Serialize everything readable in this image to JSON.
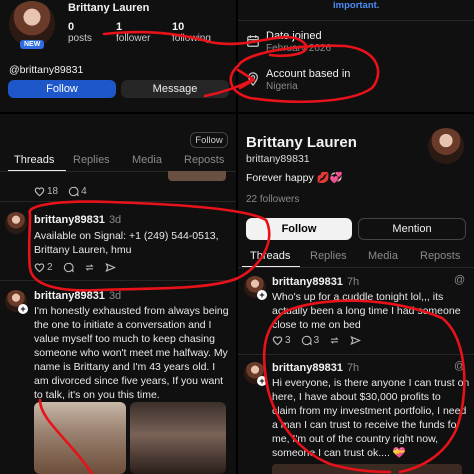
{
  "top_left": {
    "name": "Brittany Lauren",
    "badge": "NEW",
    "stats": [
      {
        "value": "0",
        "label": "posts"
      },
      {
        "value": "1",
        "label": "follower"
      },
      {
        "value": "10",
        "label": "following"
      }
    ],
    "handle": "@brittany89831",
    "follow_label": "Follow",
    "message_label": "Message"
  },
  "top_right": {
    "important": "important.",
    "date_joined_label": "Date joined",
    "date_joined_value": "February 2026",
    "account_based_label": "Account based in",
    "account_based_value": "Nigeria"
  },
  "left_feed": {
    "follow_pill": "Follow",
    "tabs": [
      "Threads",
      "Replies",
      "Media",
      "Reposts"
    ],
    "partial_counts": {
      "likes": "18",
      "comments": "4"
    },
    "posts": [
      {
        "username": "brittany89831",
        "time": "3d",
        "text": [
          "Available on Signal: +1 (249) 544-0513,",
          "Brittany Lauren, hmu"
        ],
        "likes": "2"
      },
      {
        "username": "brittany89831",
        "time": "3d",
        "text": [
          "I'm honestly exhausted from always being",
          "the one to initiate a conversation and I",
          "value myself too much to keep chasing",
          "someone who won't meet me halfway. My",
          "name is Brittany and I'm 43 years old. I",
          "am divorced since five years, If you want",
          "to talk, it's on you this time."
        ]
      }
    ]
  },
  "right_profile": {
    "name": "Brittany Lauren",
    "handle": "brittany89831",
    "bio": "Forever happy 💋💞",
    "followers": "22 followers",
    "follow_label": "Follow",
    "mention_label": "Mention",
    "tabs": [
      "Threads",
      "Replies",
      "Media",
      "Reposts"
    ],
    "posts": [
      {
        "username": "brittany89831",
        "time": "7h",
        "text": [
          "Who's up for a cuddle tonight lol,,, its",
          "actually been a long time I had someone",
          "close to me on bed"
        ],
        "likes": "3",
        "comments": "3"
      },
      {
        "username": "brittany89831",
        "time": "7h",
        "text": [
          "Hi everyone, is there anyone I can trust on",
          "here, I have about $30,000 profits to",
          "claim from my investment portfolio, I need",
          "a man I can trust to receive the funds for",
          "me, I'm out of the country right now,",
          "someone I can trust ok.... 💝"
        ]
      }
    ]
  },
  "colors": {
    "follow_blue": "#1d57c9",
    "annotation_red": "#e8121a",
    "new_badge": "#2f6de0",
    "link_blue": "#4d8df6"
  }
}
